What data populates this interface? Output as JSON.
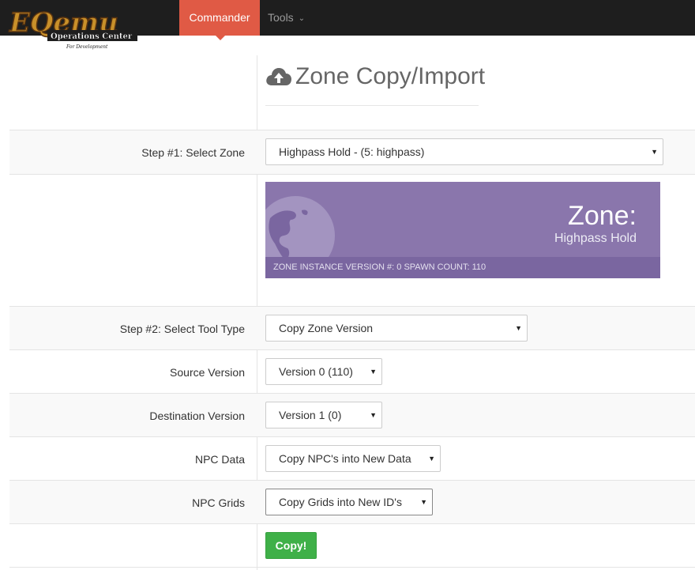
{
  "logo": {
    "main": "EQemu",
    "sub": "Operations Center",
    "tag": "For Development"
  },
  "nav": {
    "commander": "Commander",
    "tools": "Tools"
  },
  "header": {
    "title": "Zone Copy/Import",
    "icon": "cloud-upload-icon"
  },
  "step1": {
    "label": "Step #1: Select Zone",
    "value": "Highpass Hold - (5: highpass)"
  },
  "zone_card": {
    "heading": "Zone:",
    "name": "Highpass Hold",
    "footer": "ZONE INSTANCE VERSION #: 0 SPAWN COUNT: 110",
    "color": "#8a76ac",
    "icon": "globe-icon"
  },
  "step2": {
    "label": "Step #2: Select Tool Type",
    "value": "Copy Zone Version"
  },
  "source_version": {
    "label": "Source Version",
    "value": "Version 0 (110)"
  },
  "destination_version": {
    "label": "Destination Version",
    "value": "Version 1 (0)"
  },
  "npc_data": {
    "label": "NPC Data",
    "value": "Copy NPC's into New Data"
  },
  "npc_grids": {
    "label": "NPC Grids",
    "value": "Copy Grids into New ID's"
  },
  "copy_button": {
    "label": "Copy!",
    "color": "#3fb048"
  },
  "colors": {
    "nav_bg": "#1e1e1e",
    "nav_active": "#e05a45"
  }
}
